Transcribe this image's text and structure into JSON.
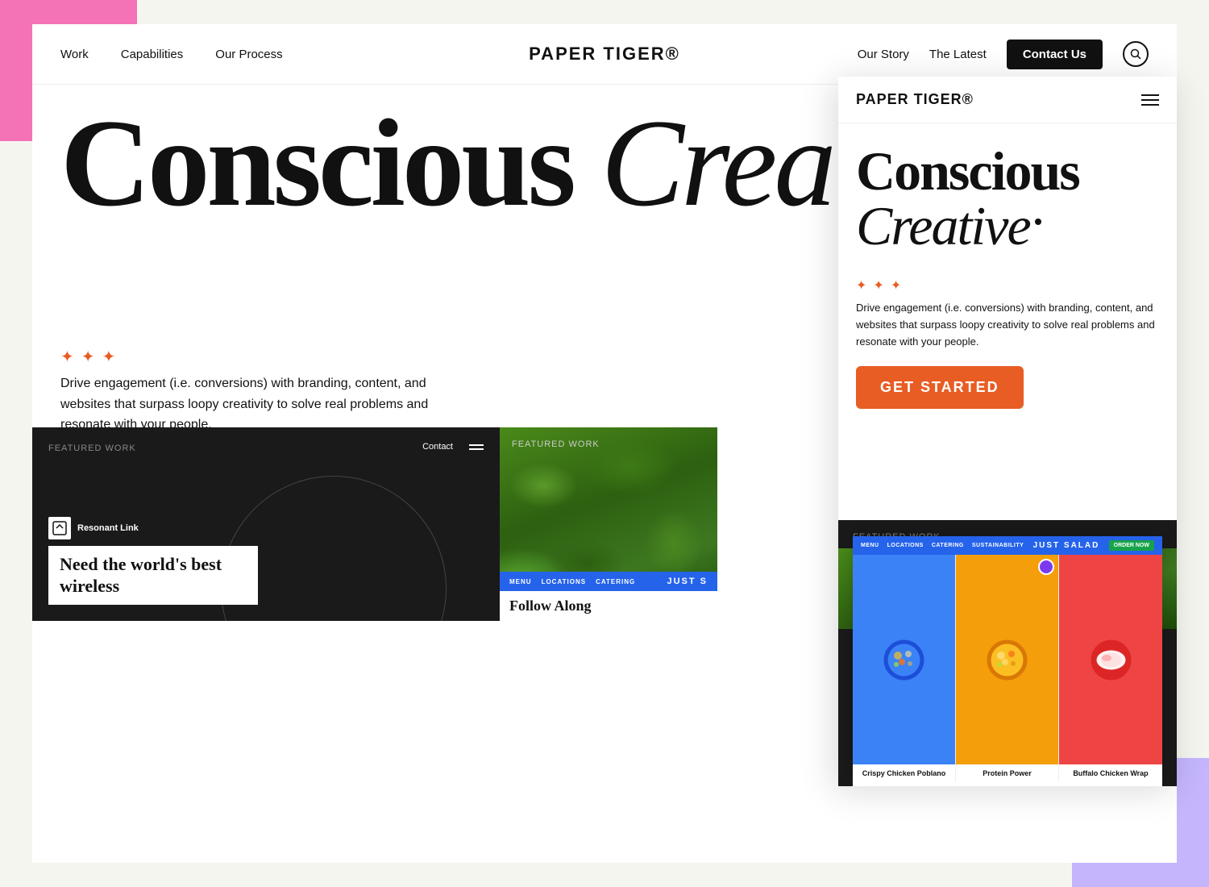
{
  "meta": {
    "title": "Paper Tiger - Conscious Creative",
    "brand": "PAPER TIGER®"
  },
  "nav": {
    "logo": "PAPER TIGER®",
    "left_links": [
      {
        "label": "Work",
        "href": "#"
      },
      {
        "label": "Capabilities",
        "href": "#"
      },
      {
        "label": "Our Process",
        "href": "#"
      }
    ],
    "right_links": [
      {
        "label": "Our Story",
        "href": "#"
      },
      {
        "label": "The Latest",
        "href": "#"
      }
    ],
    "contact_label": "Contact Us",
    "search_icon": "search"
  },
  "hero": {
    "title_part1": "Conscious ",
    "title_part2": "Crea",
    "dot_label": "bullet point"
  },
  "tagline": {
    "stars": "✦ ✦ ✦",
    "text": "Drive engagement (i.e. conversions) with branding, content, and websites that surpass loopy creativity to solve real problems and resonate with your people."
  },
  "featured_work": {
    "label": "Featured Work",
    "resonant_logo": "Resonant\nLink",
    "resonant_contact": "Contact",
    "resonant_headline": "Need the world's best wireless",
    "just_salad_nav": [
      "MENU",
      "LOCATIONS",
      "CATERING"
    ],
    "just_salad_logo": "JUST S",
    "follow_along": "Follow Along"
  },
  "mobile_popup": {
    "logo": "PAPER TIGER®",
    "hero_title_part1": "Conscious ",
    "hero_title_part2": "Creative",
    "stars": "✦ ✦ ✦",
    "tagline_text": "Drive engagement (i.e. conversions) with branding, content, and websites that surpass loopy creativity to solve real problems and resonate with your people.",
    "cta_label": "GET STARTED",
    "featured_label": "Featured Work",
    "just_salad_nav": [
      "MENU",
      "LOCATIONS",
      "CATERING"
    ],
    "just_salad_logo": "JUST SALAD",
    "just_salad_sustainability": "SUSTAINABILITY",
    "just_salad_order": "ORDER NOW",
    "products": [
      {
        "name": "Crispy Chicken Poblano",
        "bg": "#3b82f6"
      },
      {
        "name": "Protein Power",
        "bg": "#f59e0b"
      },
      {
        "name": "Buffalo Chicken Wrap",
        "bg": "#ef4444"
      }
    ]
  }
}
